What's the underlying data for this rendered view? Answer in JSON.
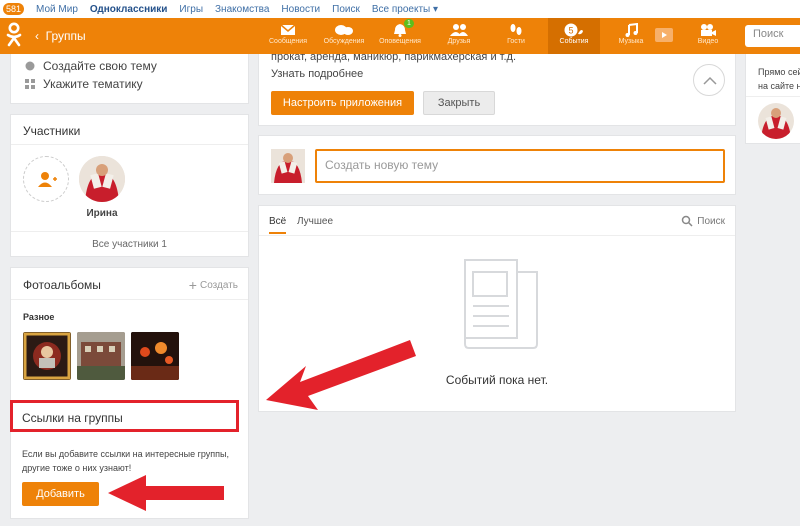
{
  "topbar": {
    "badge": "581",
    "links": [
      "Мой Мир",
      "Одноклассники",
      "Игры",
      "Знакомства",
      "Новости",
      "Поиск",
      "Все проекты ▾"
    ]
  },
  "header": {
    "back_label": "Группы",
    "nav": [
      {
        "label": "Сообщения",
        "icon": "envelope-icon"
      },
      {
        "label": "Обсуждения",
        "icon": "chat-bubbles-icon"
      },
      {
        "label": "Оповещения",
        "icon": "bell-icon",
        "badge": "1"
      },
      {
        "label": "Друзья",
        "icon": "friends-icon"
      },
      {
        "label": "Гости",
        "icon": "footprints-icon"
      },
      {
        "label": "События",
        "icon": "events-icon",
        "badge": "5"
      },
      {
        "label": "Музыка",
        "icon": "music-note-icon"
      },
      {
        "label": "Видео",
        "icon": "video-camera-icon"
      }
    ],
    "search_placeholder": "Поиск"
  },
  "left": {
    "topic_items": [
      "Создайте свою тему",
      "Укажите тематику"
    ],
    "members_title": "Участники",
    "member_name": "Ирина",
    "all_members": "Все участники 1",
    "photos_title": "Фотоальбомы",
    "photos_create": "Создать",
    "album_name": "Разное",
    "links_title": "Ссылки на группы",
    "links_desc_1": "Если вы добавите ссылки на интересные группы,",
    "links_desc_2": "другие тоже о них узнают!",
    "add_button": "Добавить"
  },
  "center": {
    "promo_text": "прокат, аренда, маникюр, парикмахерская и т.д.",
    "more_link": "Узнать подробнее",
    "setup_button": "Настроить приложения",
    "close_button": "Закрыть",
    "new_topic_placeholder": "Создать новую тему",
    "tabs": [
      "Всё",
      "Лучшее"
    ],
    "search_label": "Поиск",
    "empty_text": "Событий пока нет."
  },
  "right": {
    "line1": "Прямо сей",
    "line2": "на сайте н"
  },
  "colors": {
    "accent": "#ee8208",
    "annotation_red": "#e3222b"
  }
}
